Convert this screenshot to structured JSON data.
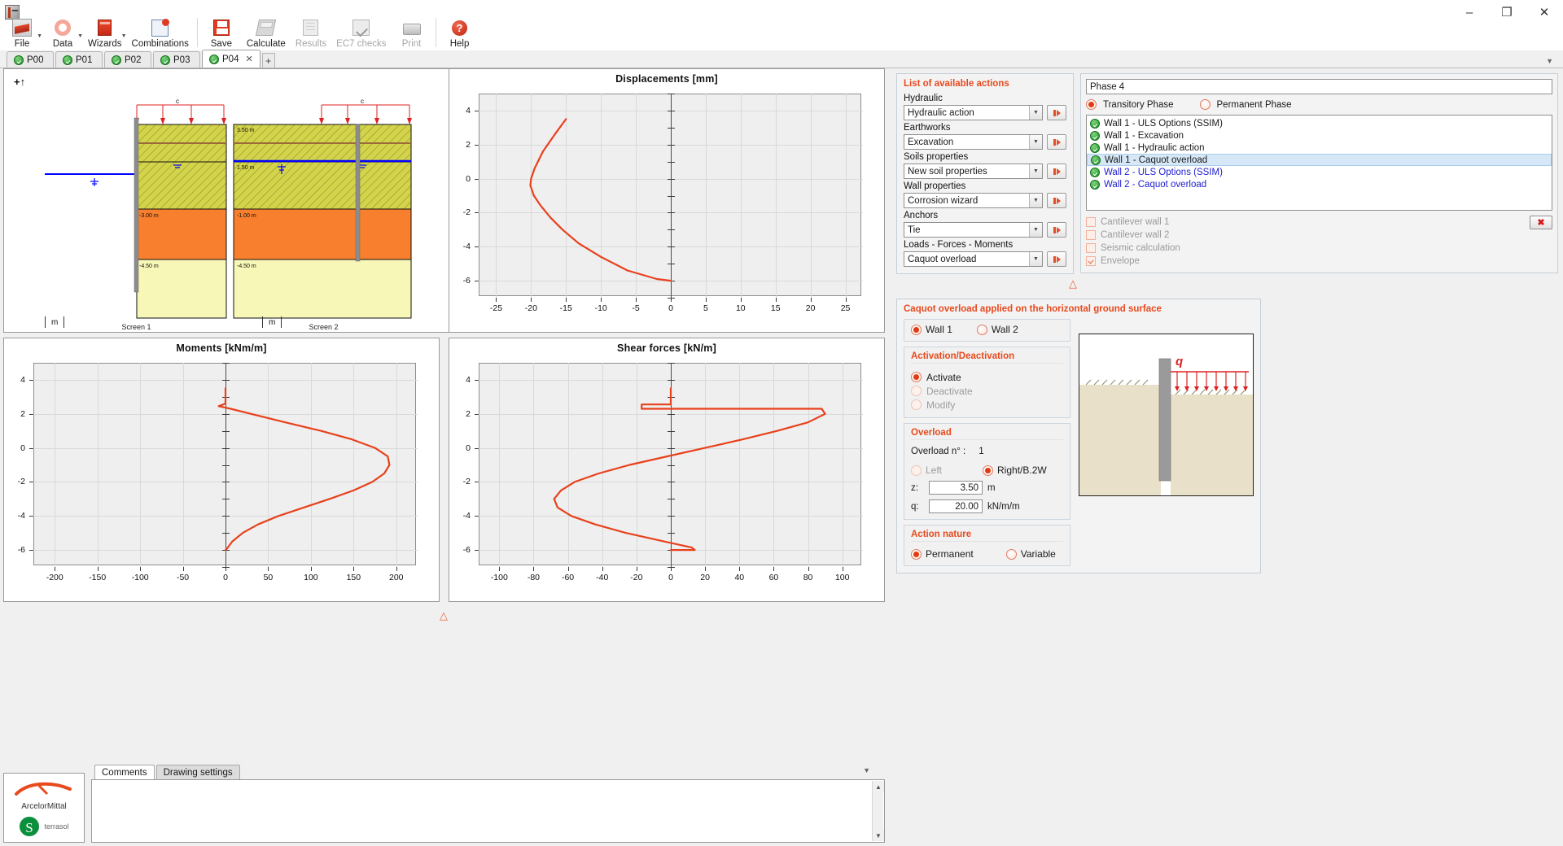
{
  "window": {
    "app_icon": "app-icon",
    "minimize": "–",
    "maximize": "❐",
    "close": "✕"
  },
  "toolbar": {
    "items": [
      {
        "label": "File",
        "icon": "file-icon",
        "caret": true,
        "disabled": false
      },
      {
        "label": "Data",
        "icon": "data-icon",
        "caret": true,
        "disabled": false
      },
      {
        "label": "Wizards",
        "icon": "wizards-icon",
        "caret": true,
        "disabled": false
      },
      {
        "label": "Combinations",
        "icon": "combinations-icon",
        "caret": false,
        "disabled": false
      },
      {
        "label": "Save",
        "icon": "save-icon",
        "caret": false,
        "disabled": false
      },
      {
        "label": "Calculate",
        "icon": "calculate-icon",
        "caret": false,
        "disabled": false
      },
      {
        "label": "Results",
        "icon": "results-icon",
        "caret": false,
        "disabled": true
      },
      {
        "label": "EC7 checks",
        "icon": "ec7-icon",
        "caret": false,
        "disabled": true
      },
      {
        "label": "Print",
        "icon": "print-icon",
        "caret": false,
        "disabled": true
      },
      {
        "label": "Help",
        "icon": "help-icon",
        "caret": false,
        "disabled": false
      }
    ]
  },
  "phase_tabs": {
    "tabs": [
      {
        "label": "P00",
        "active": false
      },
      {
        "label": "P01",
        "active": false
      },
      {
        "label": "P02",
        "active": false
      },
      {
        "label": "P03",
        "active": false
      },
      {
        "label": "P04",
        "active": true
      }
    ],
    "close_glyph": "✕",
    "add_label": "+",
    "overflow_caret": "▼"
  },
  "drawing": {
    "axis_marker": "+↑",
    "screens": [
      {
        "caption": "Screen 1",
        "scale_unit": "m",
        "load_label": "c",
        "layer_labels": [
          "-3.00 m",
          "-4.50 m"
        ]
      },
      {
        "caption": "Screen 2",
        "scale_unit": "m",
        "load_label": "c",
        "layer_labels": [
          "3.50 m",
          "1.50 m",
          "-1.00 m",
          "-4.50 m"
        ]
      }
    ]
  },
  "chart_data": [
    {
      "type": "line",
      "title": "Displacements [mm]",
      "xlabel": "",
      "ylabel": "",
      "xlim": [
        -27.5,
        27.5
      ],
      "ylim": [
        -7,
        5
      ],
      "xticks": [
        -25,
        -20,
        -15,
        -10,
        -5,
        0,
        5,
        10,
        15,
        20,
        25
      ],
      "yticks": [
        4,
        2,
        0,
        -2,
        -4,
        -6
      ],
      "grid": true,
      "legend": "none",
      "series": [
        {
          "name": "displacement",
          "color": "#e8411c",
          "points": [
            [
              -15.0,
              3.5
            ],
            [
              -16.6,
              2.6
            ],
            [
              -18.3,
              1.6
            ],
            [
              -19.5,
              0.6
            ],
            [
              -20.0,
              0.0
            ],
            [
              -20.1,
              -0.4
            ],
            [
              -19.6,
              -1.0
            ],
            [
              -18.6,
              -1.6
            ],
            [
              -17.2,
              -2.3
            ],
            [
              -15.5,
              -3.0
            ],
            [
              -13.2,
              -3.8
            ],
            [
              -10.0,
              -4.6
            ],
            [
              -6.2,
              -5.4
            ],
            [
              -2.0,
              -5.9
            ],
            [
              0.0,
              -6.0
            ]
          ]
        }
      ]
    },
    {
      "type": "line",
      "title": "Moments [kNm/m]",
      "xlabel": "",
      "ylabel": "",
      "xlim": [
        -225,
        225
      ],
      "ylim": [
        -7,
        5
      ],
      "xticks": [
        -200,
        -150,
        -100,
        -50,
        0,
        50,
        100,
        150,
        200
      ],
      "yticks": [
        4,
        2,
        0,
        -2,
        -4,
        -6
      ],
      "grid": true,
      "legend": "none",
      "series": [
        {
          "name": "moment",
          "color": "#e8411c",
          "points": [
            [
              0,
              3.5
            ],
            [
              0,
              2.6
            ],
            [
              -8,
              2.45
            ],
            [
              6,
              2.3
            ],
            [
              30,
              2.0
            ],
            [
              70,
              1.5
            ],
            [
              112,
              1.0
            ],
            [
              148,
              0.5
            ],
            [
              175,
              0.0
            ],
            [
              190,
              -0.5
            ],
            [
              192,
              -1.0
            ],
            [
              186,
              -1.5
            ],
            [
              172,
              -2.0
            ],
            [
              150,
              -2.5
            ],
            [
              122,
              -3.0
            ],
            [
              92,
              -3.5
            ],
            [
              62,
              -4.0
            ],
            [
              38,
              -4.5
            ],
            [
              20,
              -5.0
            ],
            [
              8,
              -5.5
            ],
            [
              2,
              -5.9
            ],
            [
              0,
              -6.0
            ]
          ]
        }
      ]
    },
    {
      "type": "line",
      "title": "Shear forces [kN/m]",
      "xlabel": "",
      "ylabel": "",
      "xlim": [
        -112,
        112
      ],
      "ylim": [
        -7,
        5
      ],
      "xticks": [
        -100,
        -80,
        -60,
        -40,
        -20,
        0,
        20,
        40,
        60,
        80,
        100
      ],
      "yticks": [
        4,
        2,
        0,
        -2,
        -4,
        -6
      ],
      "grid": true,
      "legend": "none",
      "series": [
        {
          "name": "shear",
          "color": "#e8411c",
          "points": [
            [
              0,
              3.5
            ],
            [
              0,
              2.55
            ],
            [
              -17,
              2.55
            ],
            [
              -17,
              2.3
            ],
            [
              88,
              2.3
            ],
            [
              90,
              2.0
            ],
            [
              80,
              1.5
            ],
            [
              62,
              1.0
            ],
            [
              42,
              0.5
            ],
            [
              20,
              0.0
            ],
            [
              -2,
              -0.5
            ],
            [
              -24,
              -1.0
            ],
            [
              -42,
              -1.5
            ],
            [
              -56,
              -2.0
            ],
            [
              -64,
              -2.5
            ],
            [
              -68,
              -3.0
            ],
            [
              -66,
              -3.5
            ],
            [
              -58,
              -4.0
            ],
            [
              -44,
              -4.5
            ],
            [
              -26,
              -5.0
            ],
            [
              -4,
              -5.5
            ],
            [
              12,
              -5.85
            ],
            [
              14,
              -6.0
            ],
            [
              0,
              -6.0
            ]
          ]
        }
      ]
    }
  ],
  "comments": {
    "tabs": [
      {
        "label": "Comments",
        "active": true
      },
      {
        "label": "Drawing settings",
        "active": false
      }
    ],
    "value": "",
    "overflow_caret": "▼",
    "scroll_up": "▲",
    "scroll_down": "▼"
  },
  "logos": {
    "primary": "ArcelorMittal",
    "secondary": "terrasol"
  },
  "actions_panel": {
    "title": "List of available actions",
    "groups": [
      {
        "label": "Hydraulic",
        "value": "Hydraulic action",
        "arrow": "▼",
        "go": "go-button"
      },
      {
        "label": "Earthworks",
        "value": "Excavation",
        "arrow": "▼",
        "go": "go-button"
      },
      {
        "label": "Soils properties",
        "value": "New soil properties",
        "arrow": "▼",
        "go": "go-button"
      },
      {
        "label": "Wall properties",
        "value": "Corrosion wizard",
        "arrow": "▼",
        "go": "go-button"
      },
      {
        "label": "Anchors",
        "value": "Tie",
        "arrow": "▼",
        "go": "go-button"
      },
      {
        "label": "Loads - Forces - Moments",
        "value": "Caquot overload",
        "arrow": "▼",
        "go": "go-button"
      }
    ]
  },
  "phase_panel": {
    "phase_name": "Phase 4",
    "transitory_label": "Transitory Phase",
    "permanent_label": "Permanent Phase",
    "transitory_selected": true,
    "permanent_selected": false,
    "actions": [
      {
        "label": "Wall 1 - ULS Options (SSIM)",
        "selected": false,
        "blue": false
      },
      {
        "label": "Wall 1 - Excavation",
        "selected": false,
        "blue": false
      },
      {
        "label": "Wall 1 - Hydraulic action",
        "selected": false,
        "blue": false
      },
      {
        "label": "Wall 1 - Caquot overload",
        "selected": true,
        "blue": false
      },
      {
        "label": "Wall 2 - ULS Options (SSIM)",
        "selected": false,
        "blue": true
      },
      {
        "label": "Wall 2 - Caquot overload",
        "selected": false,
        "blue": true
      }
    ],
    "checkboxes": [
      {
        "label": "Cantilever wall 1",
        "checked": false
      },
      {
        "label": "Cantilever wall 2",
        "checked": false
      },
      {
        "label": "Seismic calculation",
        "checked": false
      },
      {
        "label": "Envelope",
        "checked": true
      }
    ],
    "delete_label": "✖"
  },
  "caquot_panel": {
    "title": "Caquot overload applied on the horizontal ground surface",
    "wall_options": [
      {
        "label": "Wall 1",
        "selected": true
      },
      {
        "label": "Wall 2",
        "selected": false
      }
    ],
    "activation": {
      "title": "Activation/Deactivation",
      "options": [
        {
          "label": "Activate",
          "selected": true,
          "enabled": true
        },
        {
          "label": "Deactivate",
          "selected": false,
          "enabled": false
        },
        {
          "label": "Modify",
          "selected": false,
          "enabled": false
        }
      ]
    },
    "overload": {
      "title": "Overload",
      "number_label": "Overload n° :",
      "number_value": "1",
      "side_options": [
        {
          "label": "Left",
          "selected": false
        },
        {
          "label": "Right/B.2W",
          "selected": true
        }
      ],
      "fields": [
        {
          "name": "z:",
          "value": "3.50",
          "unit": "m"
        },
        {
          "name": "q:",
          "value": "20.00",
          "unit": "kN/m/m"
        }
      ]
    },
    "action_nature": {
      "title": "Action nature",
      "options": [
        {
          "label": "Permanent",
          "selected": true
        },
        {
          "label": "Variable",
          "selected": false
        }
      ]
    },
    "preview": {
      "load_symbol": "q",
      "caption": "caquot-overload-preview"
    }
  },
  "colors": {
    "accent": "#e8491d",
    "curve": "#e8411c",
    "soil_top": "#d4d44a",
    "soil_mid": "#f77f2e",
    "soil_bottom": "#f7f7b8",
    "water": "#0000ff",
    "wall": "#8c8c8c"
  }
}
